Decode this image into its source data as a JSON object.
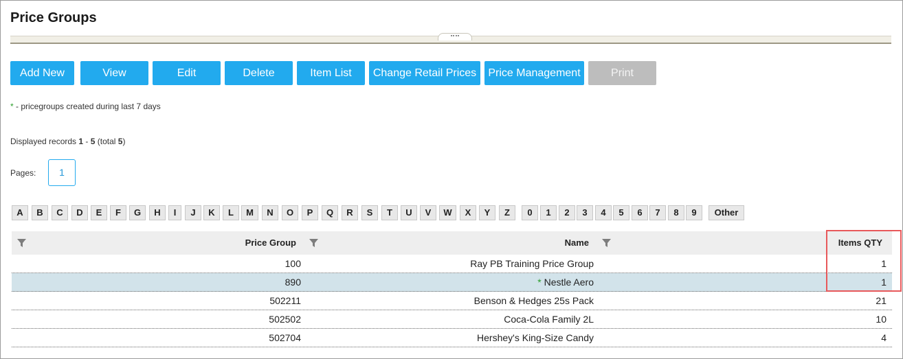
{
  "page": {
    "title": "Price Groups"
  },
  "toolbar": {
    "buttons": [
      {
        "label": "Add New",
        "enabled": true
      },
      {
        "label": "View",
        "enabled": true
      },
      {
        "label": "Edit",
        "enabled": true
      },
      {
        "label": "Delete",
        "enabled": true
      },
      {
        "label": "Item List",
        "enabled": true
      },
      {
        "label": "Change Retail Prices",
        "enabled": true
      },
      {
        "label": "Price Management",
        "enabled": true
      },
      {
        "label": "Print",
        "enabled": false
      }
    ]
  },
  "legend": {
    "star": "*",
    "text": " - pricegroups created during last 7 days"
  },
  "records": {
    "prefix": "Displayed records ",
    "from": "1",
    "dash": " - ",
    "to": "5",
    "total_prefix": " (total ",
    "total": "5",
    "total_suffix": ")"
  },
  "pagination": {
    "label": "Pages:",
    "current": "1"
  },
  "alpha_filter": [
    "A",
    "B",
    "C",
    "D",
    "E",
    "F",
    "G",
    "H",
    "I",
    "J",
    "K",
    "L",
    "M",
    "N",
    "O",
    "P",
    "Q",
    "R",
    "S",
    "T",
    "U",
    "V",
    "W",
    "X",
    "Y",
    "Z",
    "0",
    "1",
    "2",
    "3",
    "4",
    "5",
    "6",
    "7",
    "8",
    "9",
    "Other"
  ],
  "table": {
    "columns": [
      "Price Group",
      "Name",
      "Items QTY"
    ],
    "rows": [
      {
        "group": "100",
        "star": "",
        "name": "Ray PB Training Price Group",
        "qty": "1",
        "selected": false
      },
      {
        "group": "890",
        "star": "* ",
        "name": "Nestle Aero",
        "qty": "1",
        "selected": true
      },
      {
        "group": "502211",
        "star": "",
        "name": "Benson & Hedges 25s Pack",
        "qty": "21",
        "selected": false
      },
      {
        "group": "502502",
        "star": "",
        "name": "Coca-Cola Family 2L",
        "qty": "10",
        "selected": false
      },
      {
        "group": "502704",
        "star": "",
        "name": "Hershey's King-Size Candy",
        "qty": "4",
        "selected": false
      }
    ]
  },
  "colors": {
    "primary": "#22aaee",
    "disabled": "#bdbdbd",
    "selected_row": "#d2e3ea",
    "highlight": "#e8585a",
    "new_star": "#2a9d2a"
  }
}
